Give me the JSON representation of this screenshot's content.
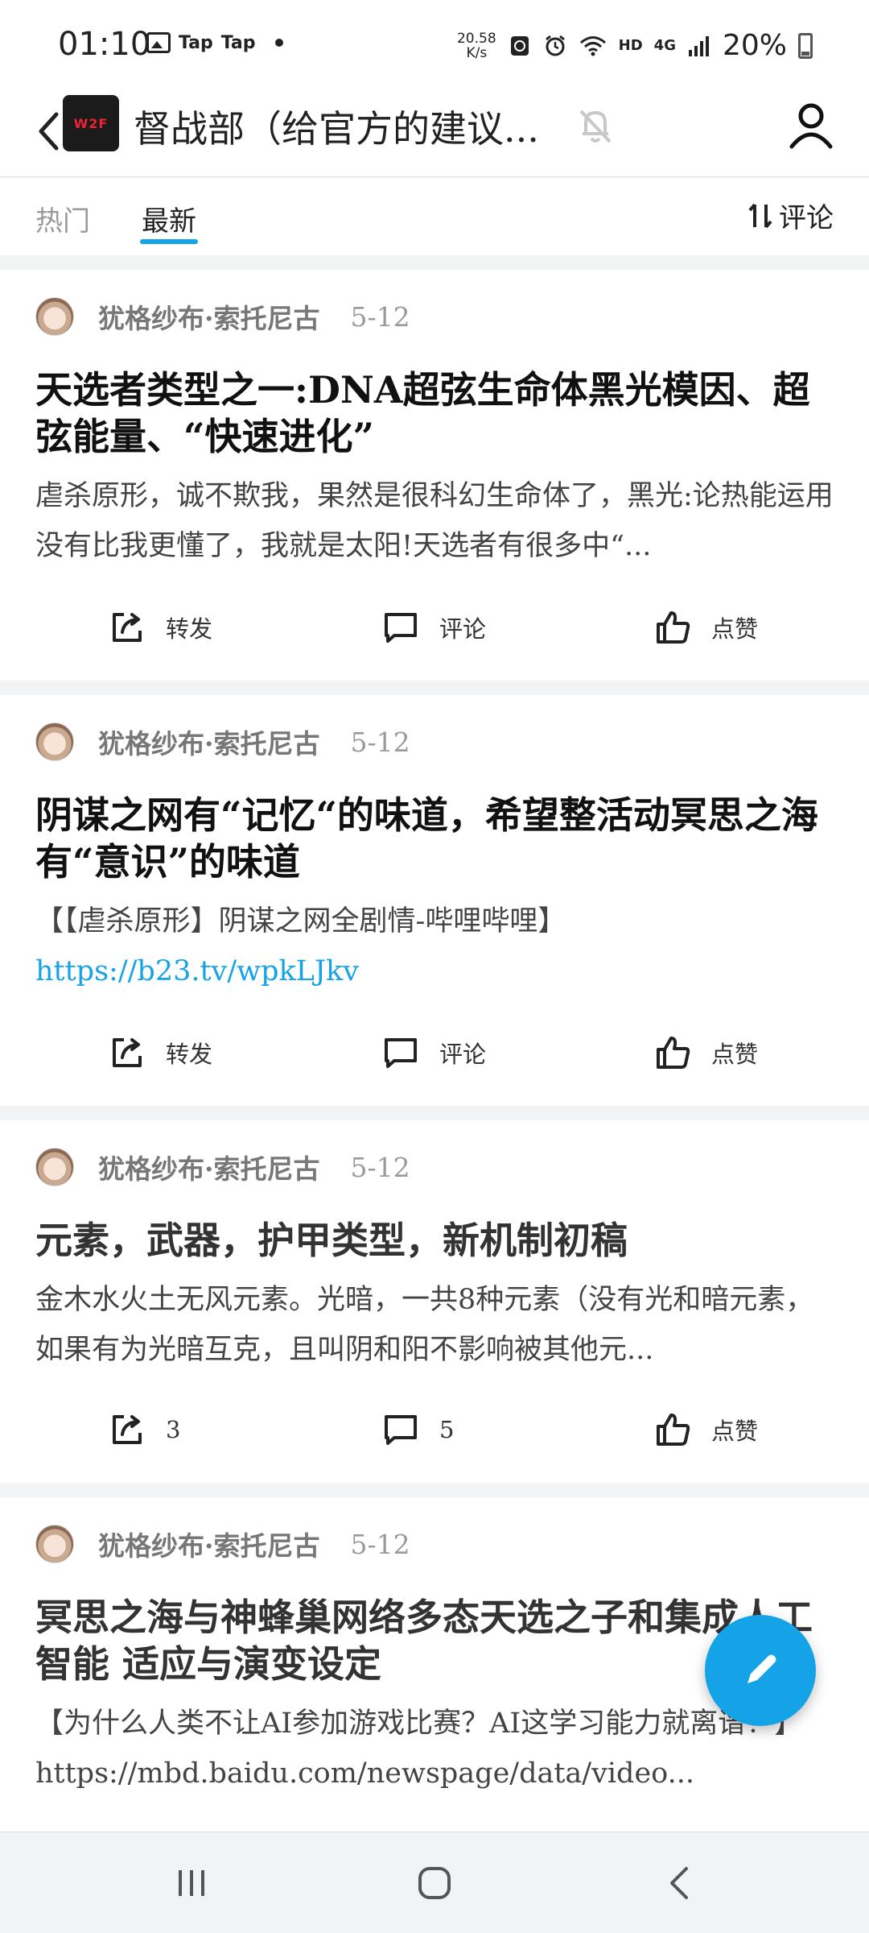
{
  "status_bar": {
    "time": "01:10",
    "app1": "Tap",
    "app2": "Tap",
    "speed_value": "20.58",
    "speed_unit": "K/s",
    "hd": "HD",
    "network": "4G",
    "battery": "20%"
  },
  "header": {
    "title": "督战部（给官方的建议...",
    "avatar_text": "W2F"
  },
  "tabs": {
    "hot": "热门",
    "latest": "最新",
    "sort_label": "评论",
    "active": "latest"
  },
  "posts": [
    {
      "author": "犹格纱布·索托尼古",
      "date": "5-12",
      "title": "天选者类型之一:DNA超弦生命体黑光模因、超弦能量、“快速进化”",
      "body": "虐杀原形，诚不欺我，果然是很科幻生命体了，黑光:论热能运用没有比我更懂了，我就是太阳!天选者有很多中“...",
      "share": "转发",
      "comment": "评论",
      "like": "点赞"
    },
    {
      "author": "犹格纱布·索托尼古",
      "date": "5-12",
      "title": "阴谋之网有“记忆“的味道，希望整活动冥思之海有“意识”的味道",
      "body": "【【虐杀原形】阴谋之网全剧情-哔哩哔哩】",
      "link": "https://b23.tv/wpkLJkv",
      "share": "转发",
      "comment": "评论",
      "like": "点赞"
    },
    {
      "author": "犹格纱布·索托尼古",
      "date": "5-12",
      "title": "元素，武器，护甲类型，新机制初稿",
      "body": "金木水火土无风元素。光暗，一共8种元素（没有光和暗元素，如果有为光暗互克，且叫阴和阳不影响被其他元...",
      "share": "3",
      "comment": "5",
      "like": "点赞"
    },
    {
      "author": "犹格纱布·索托尼古",
      "date": "5-12",
      "title": "冥思之海与神蜂巢网络多态天选之子和集成人工智能 适应与演变设定",
      "body": "【为什么人类不让AI参加游戏比赛？AI这学习能力就离谱！】https://mbd.baidu.com/newspage/data/video..."
    }
  ],
  "colors": {
    "accent": "#15a3e8",
    "background": "#f2f3f5"
  }
}
